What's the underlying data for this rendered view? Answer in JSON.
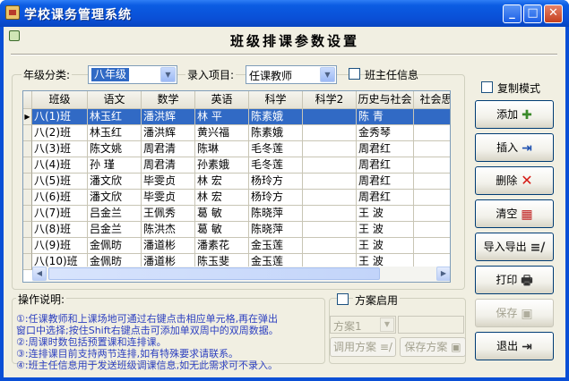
{
  "window": {
    "title": "学校课务管理系统",
    "minimize": "_",
    "maximize": "□",
    "close": "✕"
  },
  "page": {
    "title": "班级排课参数设置"
  },
  "filters": {
    "grade_label": "年级分类:",
    "grade_value": "八年级",
    "entry_label": "录入项目:",
    "entry_value": "任课教师",
    "head_teacher_label": "班主任信息"
  },
  "grid": {
    "columns": [
      "班级",
      "语文",
      "数学",
      "英语",
      "科学",
      "科学2",
      "历史与社会",
      "社会思"
    ],
    "rows": [
      [
        "八(1)班",
        "林玉红",
        "潘洪辉",
        "林 平",
        "陈素娥",
        "",
        "陈 青",
        ""
      ],
      [
        "八(2)班",
        "林玉红",
        "潘洪辉",
        "黄兴福",
        "陈素娥",
        "",
        "金秀琴",
        ""
      ],
      [
        "八(3)班",
        "陈文姚",
        "周君清",
        "陈琳",
        "毛冬莲",
        "",
        "周君红",
        ""
      ],
      [
        "八(4)班",
        "孙 瑾",
        "周君清",
        "孙素娥",
        "毛冬莲",
        "",
        "周君红",
        ""
      ],
      [
        "八(5)班",
        "潘文欣",
        "毕雯贞",
        "林 宏",
        "杨玲方",
        "",
        "周君红",
        ""
      ],
      [
        "八(6)班",
        "潘文欣",
        "毕雯贞",
        "林 宏",
        "杨玲方",
        "",
        "周君红",
        ""
      ],
      [
        "八(7)班",
        "吕金兰",
        "王佩秀",
        "葛 敏",
        "陈晓萍",
        "",
        "王 波",
        ""
      ],
      [
        "八(8)班",
        "吕金兰",
        "陈洪杰",
        "葛 敏",
        "陈晓萍",
        "",
        "王 波",
        ""
      ],
      [
        "八(9)班",
        "金佩昉",
        "潘道彬",
        "潘素花",
        "金玉莲",
        "",
        "王 波",
        ""
      ],
      [
        "八(10)班",
        "金佩昉",
        "潘道彬",
        "陈玉斐",
        "金玉莲",
        "",
        "王 波",
        ""
      ]
    ],
    "selected_row": 0,
    "row_indicator": "▶"
  },
  "help": {
    "title": "操作说明:",
    "lines": [
      "①:任课教师和上课场地可通过右键点击相应单元格,再在弹出",
      "窗口中选择;按住Shift右键点击可添加单双周中的双周数据。",
      "②:周课时数包括预置课和连排课。",
      "③:连排课目前支持两节连排,如有特殊要求请联系。",
      "④:班主任信息用于发送班级调课信息,如无此需求可不录入。"
    ]
  },
  "plan": {
    "enable_label": "方案启用",
    "combo_value": "方案1",
    "use_button": "调用方案",
    "save_button": "保存方案"
  },
  "actions": {
    "copy_mode_label": "复制模式",
    "add": "添加",
    "insert": "插入",
    "delete": "删除",
    "clear": "清空",
    "import_export": "导入导出",
    "print": "打印",
    "save": "保存",
    "exit": "退出"
  },
  "colors": {
    "titlebar": "#0a4fd6",
    "selection": "#316ac5",
    "help_text": "#2c3fc0",
    "client_bg": "#f1efe2"
  }
}
